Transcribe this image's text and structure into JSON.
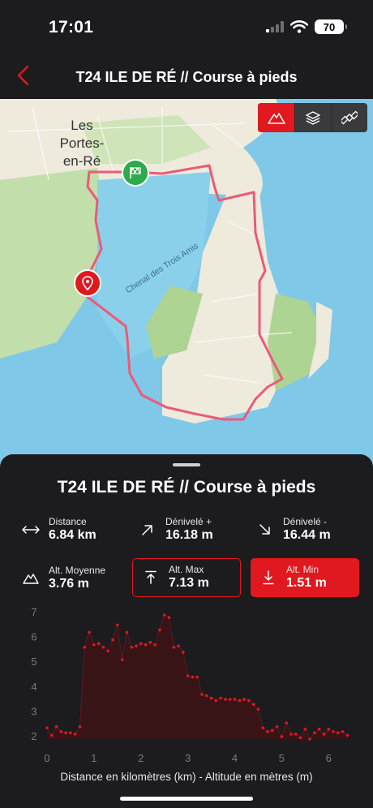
{
  "status": {
    "time": "17:01",
    "battery": "70"
  },
  "header": {
    "title": "T24 ILE DE RÉ // Course à pieds"
  },
  "map": {
    "town_label_lines": [
      "Les",
      "Portes-",
      "en-Ré"
    ],
    "channel_label": "Chenal des Trois Amis",
    "controls": [
      "mountain-icon",
      "layers-icon",
      "satellite-icon"
    ],
    "colors": {
      "water": "#7fc8e8",
      "land": "#eeeadc",
      "vegetation": "#c2deaa",
      "track": "#ec5a78",
      "start": "#2eaa4a",
      "end": "#e0181f"
    }
  },
  "sheet": {
    "title": "T24 ILE DE RÉ // Course à pieds",
    "stats": {
      "distance": {
        "label": "Distance",
        "value": "6.84 km"
      },
      "gain": {
        "label": "Dénivelé +",
        "value": "16.18 m"
      },
      "loss": {
        "label": "Dénivelé -",
        "value": "16.44 m"
      },
      "avg": {
        "label": "Alt. Moyenne",
        "value": "3.76 m"
      },
      "max": {
        "label": "Alt. Max",
        "value": "7.13 m"
      },
      "min": {
        "label": "Alt. Min",
        "value": "1.51 m"
      }
    },
    "accent": "#e0181f"
  },
  "chart_data": {
    "type": "area",
    "title": "",
    "xlabel": "Distance en kilomètres (km) - Altitude en mètres (m)",
    "ylabel": "",
    "xlim": [
      0,
      6.6
    ],
    "ylim": [
      1.9,
      7.1
    ],
    "x_ticks": [
      "0",
      "1",
      "2",
      "3",
      "4",
      "5",
      "6"
    ],
    "y_ticks": [
      "2",
      "3",
      "4",
      "5",
      "6",
      "7"
    ],
    "grid": false,
    "series": [
      {
        "x": [
          0.0,
          0.1,
          0.2,
          0.3,
          0.4,
          0.5,
          0.6,
          0.7,
          0.8,
          0.9,
          1.0,
          1.1,
          1.2,
          1.3,
          1.4,
          1.5,
          1.6,
          1.7,
          1.8,
          1.9,
          2.0,
          2.1,
          2.2,
          2.3,
          2.4,
          2.5,
          2.6,
          2.7,
          2.8,
          2.9,
          3.0,
          3.1,
          3.2,
          3.3,
          3.4,
          3.5,
          3.6,
          3.7,
          3.8,
          3.9,
          4.0,
          4.1,
          4.2,
          4.3,
          4.4,
          4.5,
          4.6,
          4.7,
          4.8,
          4.9,
          5.0,
          5.1,
          5.2,
          5.3,
          5.4,
          5.5,
          5.6,
          5.7,
          5.8,
          5.9,
          6.0,
          6.1,
          6.2,
          6.3,
          6.4
        ],
        "values": [
          2.35,
          2.05,
          2.4,
          2.2,
          2.15,
          2.15,
          2.1,
          2.4,
          5.6,
          6.2,
          5.7,
          5.75,
          5.6,
          5.45,
          5.9,
          6.5,
          5.1,
          6.2,
          5.6,
          5.65,
          5.75,
          5.7,
          5.8,
          5.7,
          6.3,
          6.9,
          6.8,
          5.6,
          5.65,
          5.4,
          4.45,
          4.4,
          4.4,
          3.7,
          3.65,
          3.55,
          3.45,
          3.55,
          3.5,
          3.5,
          3.5,
          3.45,
          3.5,
          3.45,
          3.3,
          3.1,
          2.35,
          2.2,
          2.25,
          2.4,
          2.0,
          2.55,
          2.1,
          2.1,
          1.95,
          2.3,
          1.9,
          2.15,
          2.3,
          2.1,
          2.3,
          2.2,
          2.15,
          2.2,
          2.05
        ]
      }
    ],
    "colors": {
      "line": "#e0181f",
      "fill": "#3a1416",
      "axis_text": "#7a7a7a"
    }
  }
}
